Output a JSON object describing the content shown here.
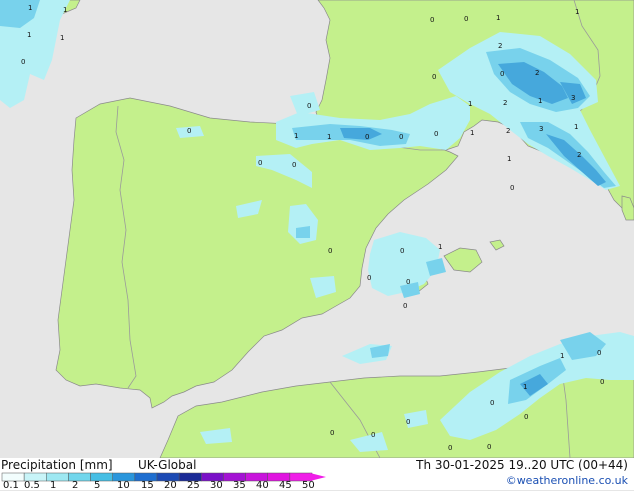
{
  "map": {
    "colors": {
      "sea": "#e6e6e6",
      "land": "#c4f08c",
      "coast": "#8a8a8a",
      "border": "#9a9a9a",
      "precip_light": "#b4f0f5",
      "precip_medium": "#78d2ec",
      "precip_heavy": "#46a8dc"
    },
    "value_labels": [
      {
        "text": "1"
      },
      {
        "text": "1"
      },
      {
        "text": "1"
      },
      {
        "text": "1"
      },
      {
        "text": "0"
      },
      {
        "text": "0"
      },
      {
        "text": "0"
      },
      {
        "text": "1"
      },
      {
        "text": "1"
      },
      {
        "text": "2"
      },
      {
        "text": "0"
      },
      {
        "text": "0"
      },
      {
        "text": "2"
      },
      {
        "text": "0"
      },
      {
        "text": "1"
      },
      {
        "text": "2"
      },
      {
        "text": "1"
      },
      {
        "text": "3"
      },
      {
        "text": "1"
      },
      {
        "text": "1"
      },
      {
        "text": "0"
      },
      {
        "text": "0"
      },
      {
        "text": "0"
      },
      {
        "text": "1"
      },
      {
        "text": "2"
      },
      {
        "text": "3"
      },
      {
        "text": "1"
      },
      {
        "text": "0"
      },
      {
        "text": "0"
      },
      {
        "text": "0"
      },
      {
        "text": "1"
      },
      {
        "text": "2"
      },
      {
        "text": "0"
      },
      {
        "text": "0"
      },
      {
        "text": "0"
      },
      {
        "text": "1"
      },
      {
        "text": "0"
      },
      {
        "text": "0"
      },
      {
        "text": "0"
      },
      {
        "text": "0"
      },
      {
        "text": "1"
      },
      {
        "text": "0"
      },
      {
        "text": "0"
      },
      {
        "text": "1"
      },
      {
        "text": "0"
      },
      {
        "text": "0"
      },
      {
        "text": "0"
      },
      {
        "text": "0"
      },
      {
        "text": "0"
      },
      {
        "text": "0"
      }
    ]
  },
  "legend": {
    "title": "Precipitation [mm]",
    "model": "UK-Global",
    "scale_labels": [
      "0.1",
      "0.5",
      "1",
      "2",
      "5",
      "10",
      "15",
      "20",
      "25",
      "30",
      "35",
      "40",
      "45",
      "50"
    ],
    "scale_colors": [
      "#f2fdfd",
      "#c8f4f8",
      "#9ee8f2",
      "#72d6ec",
      "#46bee4",
      "#2a96dc",
      "#1e6ed0",
      "#1c4ab4",
      "#1a2a96",
      "#7a10c8",
      "#a412d4",
      "#c814dc",
      "#e014e0",
      "#f01ee8"
    ]
  },
  "footer": {
    "timestamp": "Th 30-01-2025 19..20 UTC (00+44)",
    "credit": "©weatheronline.co.uk"
  }
}
